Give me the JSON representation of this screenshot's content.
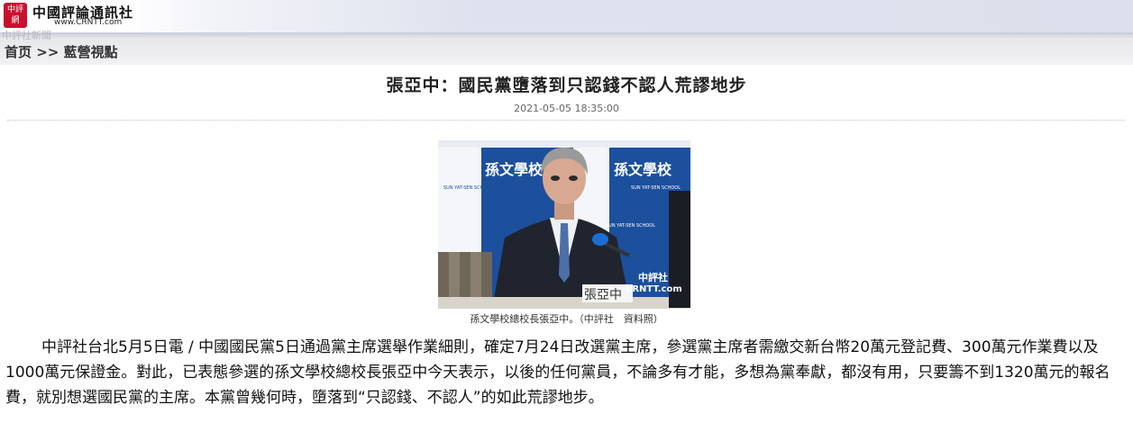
{
  "header": {
    "seal_text": "中評網",
    "logo_name": "中國評論通訊社",
    "logo_url": "www.CRNTT.com",
    "faded_label": "中評社新聞"
  },
  "breadcrumb": {
    "home": "首页",
    "separator": ">>",
    "section": "藍營視點"
  },
  "article": {
    "title": "張亞中：國民黨墮落到只認錢不認人荒謬地步",
    "datetime": "2021-05-05 18:35:00",
    "photo": {
      "banner_text": "孫文學校",
      "school_en": "SUN YAT-SEN SCHOOL",
      "nameplate": "張亞中",
      "watermark_cn": "中評社",
      "watermark_url": "CRNTT.com"
    },
    "caption": "孫文學校總校長張亞中。（中評社　資料照）",
    "body": "中評社台北5月5日電 / 中國國民黨5日通過黨主席選舉作業細則，確定7月24日改選黨主席，參選黨主席者需繳交新台幣20萬元登記費、300萬元作業費以及1000萬元保證金。對此，已表態參選的孫文學校總校長張亞中今天表示，以後的任何黨員，不論多有才能，多想為黨奉獻，都沒有用，只要籌不到1320萬元的報名費，就別想選國民黨的主席。本黨曾幾何時，墮落到“只認錢、不認人”的如此荒謬地步。"
  },
  "colors": {
    "seal_red": "#c8102e",
    "banner_blue": "#1c4f9c"
  }
}
